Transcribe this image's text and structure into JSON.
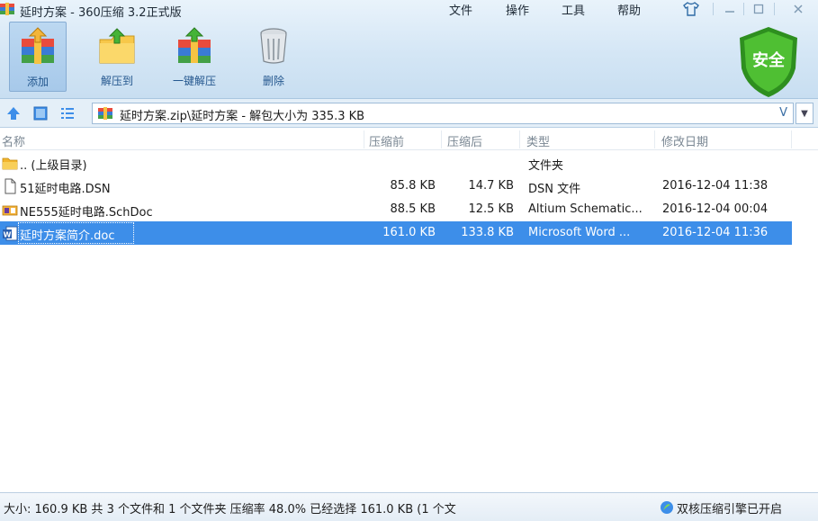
{
  "window": {
    "title": "延时方案 - 360压缩 3.2正式版",
    "menus": [
      "文件",
      "操作",
      "工具",
      "帮助"
    ]
  },
  "toolbar": {
    "add": "添加",
    "extract_to": "解压到",
    "one_click_extract": "一键解压",
    "delete": "删除"
  },
  "security_badge": "安全",
  "address": {
    "path": "延时方案.zip\\延时方案 - 解包大小为 335.3 KB",
    "v_label": "V"
  },
  "columns": {
    "name": "名称",
    "compressed_before": "压缩前",
    "compressed_after": "压缩后",
    "type": "类型",
    "modified": "修改日期"
  },
  "files": [
    {
      "name": ".. (上级目录)",
      "before": "",
      "after": "",
      "type": "文件夹",
      "modified": "",
      "icon": "folder-icon"
    },
    {
      "name": "51延时电路.DSN",
      "before": "85.8 KB",
      "after": "14.7 KB",
      "type": "DSN 文件",
      "modified": "2016-12-04 11:38",
      "icon": "blank-file-icon"
    },
    {
      "name": "NE555延时电路.SchDoc",
      "before": "88.5 KB",
      "after": "12.5 KB",
      "type": "Altium Schematic...",
      "modified": "2016-12-04 00:04",
      "icon": "schdoc-file-icon"
    },
    {
      "name": "延时方案简介.doc",
      "before": "161.0 KB",
      "after": "133.8 KB",
      "type": "Microsoft Word ...",
      "modified": "2016-12-04 11:36",
      "icon": "word-doc-icon"
    }
  ],
  "selected_index": 3,
  "status": {
    "summary": "大小: 160.9 KB 共 3 个文件和 1 个文件夹 压缩率 48.0% 已经选择 161.0 KB (1 个文",
    "engine": "双核压缩引擎已开启"
  },
  "colors": {
    "selection": "#3d8ee9",
    "toolbar_label": "#24578e",
    "shield": "#43b02a"
  }
}
